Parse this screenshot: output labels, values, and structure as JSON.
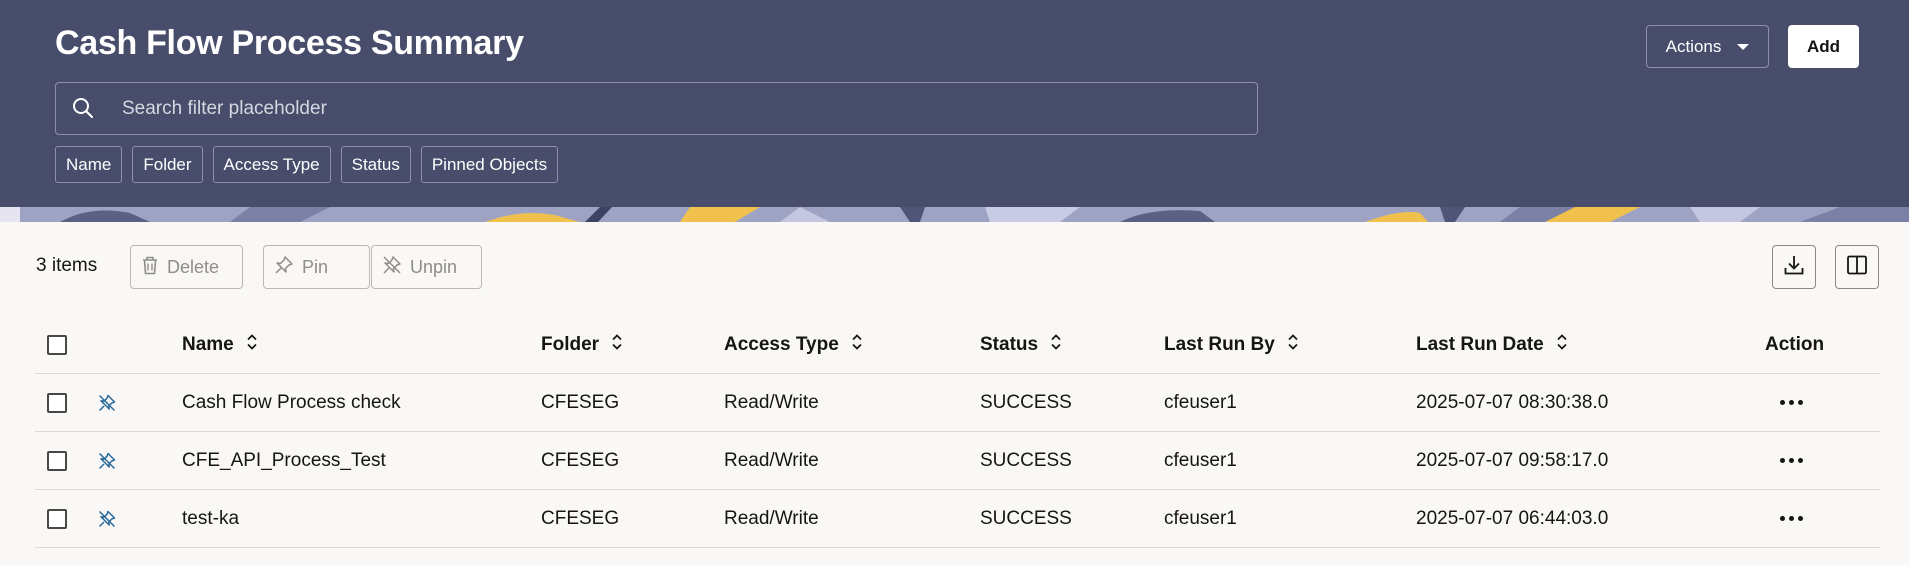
{
  "header": {
    "title": "Cash Flow Process Summary",
    "actions_label": "Actions",
    "add_label": "Add",
    "search_placeholder": "Search filter placeholder",
    "filter_chips": [
      "Name",
      "Folder",
      "Access Type",
      "Status",
      "Pinned Objects"
    ],
    "background_color": "#474d6a"
  },
  "toolbar": {
    "item_count": "3 items",
    "delete_label": "Delete",
    "pin_label": "Pin",
    "unpin_label": "Unpin"
  },
  "table": {
    "columns": [
      "Name",
      "Folder",
      "Access Type",
      "Status",
      "Last Run By",
      "Last Run Date",
      "Action"
    ],
    "rows": [
      {
        "name": "Cash Flow Process check",
        "folder": "CFESEG",
        "access_type": "Read/Write",
        "status": "SUCCESS",
        "last_run_by": "cfeuser1",
        "last_run_date": "2025-07-07 08:30:38.0"
      },
      {
        "name": "CFE_API_Process_Test",
        "folder": "CFESEG",
        "access_type": "Read/Write",
        "status": "SUCCESS",
        "last_run_by": "cfeuser1",
        "last_run_date": "2025-07-07 09:58:17.0"
      },
      {
        "name": "test-ka",
        "folder": "CFESEG",
        "access_type": "Read/Write",
        "status": "SUCCESS",
        "last_run_by": "cfeuser1",
        "last_run_date": "2025-07-07 06:44:03.0"
      }
    ]
  },
  "icons": {
    "search": "search-icon",
    "delete": "trash-icon",
    "pin": "pin-icon",
    "unpin": "unpin-icon",
    "download": "download-icon",
    "columns": "columns-icon",
    "row_pin_state": "unpinned-icon",
    "row_action": "more-options-icon"
  },
  "colors": {
    "accent_blue": "#2b6a9a",
    "disabled_text": "#8f8d89"
  }
}
